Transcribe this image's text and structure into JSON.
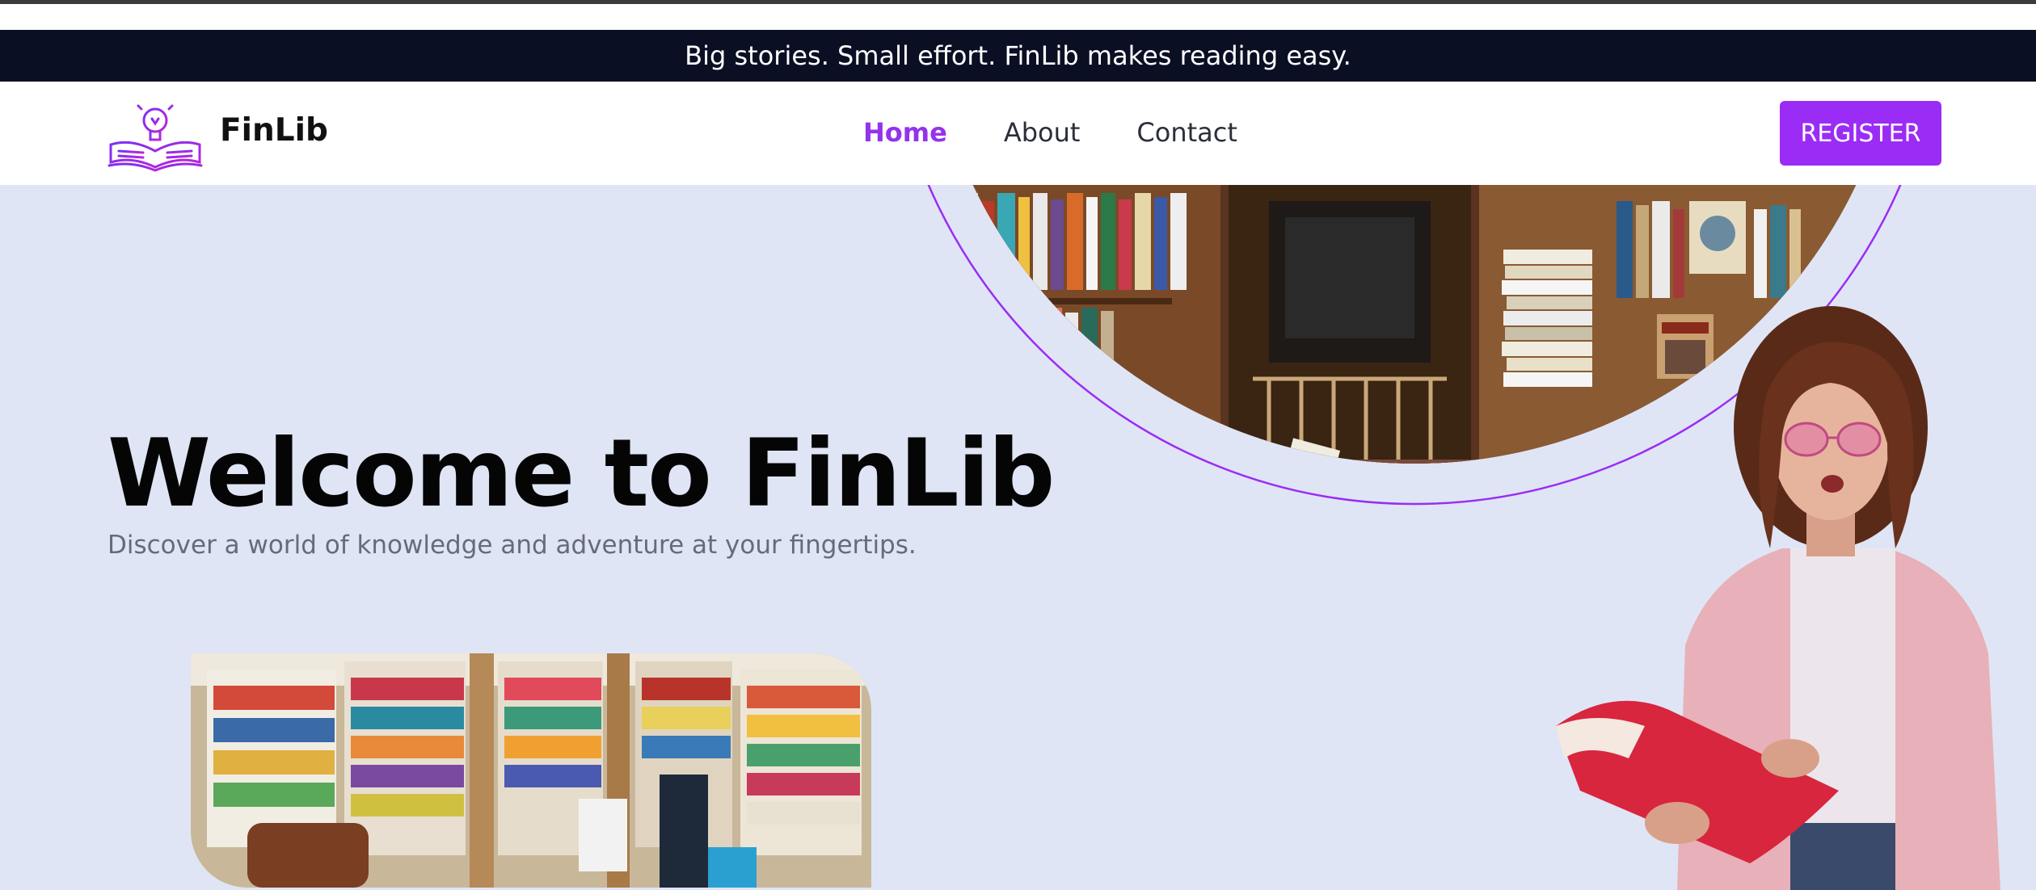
{
  "announcement": "Big stories. Small effort. FinLib makes reading easy.",
  "brand": {
    "name": "FinLib",
    "logo_icon": "lightbulb-book-icon"
  },
  "nav": {
    "links": [
      {
        "label": "Home",
        "active": true
      },
      {
        "label": "About",
        "active": false
      },
      {
        "label": "Contact",
        "active": false
      }
    ],
    "register_label": "REGISTER"
  },
  "hero": {
    "title": "Welcome to FinLib",
    "subtitle": "Discover a world of knowledge and adventure at your fingertips."
  },
  "colors": {
    "accent": "#9b2cf5",
    "announcement_bg": "#0a0f24",
    "hero_bg": "#dfe5f5"
  }
}
